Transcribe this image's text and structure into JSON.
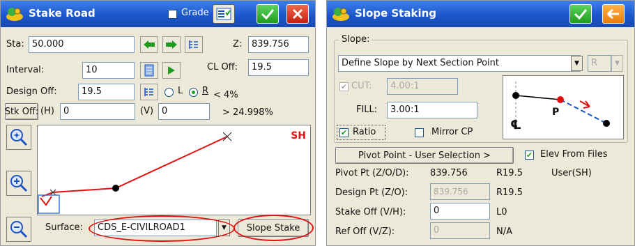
{
  "stake_road": {
    "title": "Stake Road",
    "grade_label": "Grade",
    "sta_label": "Sta:",
    "sta_value": "50.000",
    "z_label": "Z:",
    "z_value": "839.756",
    "interval_label": "Interval:",
    "interval_value": "10",
    "cl_off_label": "CL Off:",
    "cl_off_value": "19.5",
    "design_off_label": "Design Off:",
    "design_off_value": "19.5",
    "radio_l_label": "L",
    "radio_r_label": "R",
    "slope_low": "< 4%",
    "slope_high": "> 24.998%",
    "stk_off_label": "Stk Off:",
    "h_label": "(H)",
    "h_value": "0",
    "v_label": "(V)",
    "v_value": "0",
    "sh_badge": "SH",
    "surface_label": "Surface:",
    "surface_value": "CDS_E-CIVILROAD1",
    "slope_stake_button": "Slope Stake",
    "highlight_color": "#e01010",
    "line_color": "#e01010"
  },
  "slope_staking": {
    "title": "Slope Staking",
    "slope_group_label": "Slope:",
    "slope_method": "Define Slope by Next Section Point",
    "side_value": "R",
    "cut_label": "CUT:",
    "cut_value": "4.00:1",
    "fill_label": "FILL:",
    "fill_value": "3.00:1",
    "ratio_label": "Ratio",
    "mirror_cp_label": "Mirror CP",
    "diagram_point_label": "P",
    "diagram_cl_label": "℄",
    "pivot_button": "Pivot Point - User Selection >",
    "elev_from_files_label": "Elev From Files",
    "pivot_pt_label": "Pivot Pt (Z/O/D):",
    "pivot_pt_z": "839.756",
    "pivot_pt_o": "R19.5",
    "pivot_pt_d": "User(SH)",
    "design_pt_label": "Design Pt (Z/O):",
    "design_pt_z": "839.756",
    "design_pt_o": "R19.5",
    "stake_off_label": "Stake Off (V/H):",
    "stake_off_value": "0",
    "stake_off_h": "L0",
    "ref_off_label": "Ref Off (V/Z):",
    "ref_off_value": "0",
    "ref_off_z": "N/A"
  }
}
